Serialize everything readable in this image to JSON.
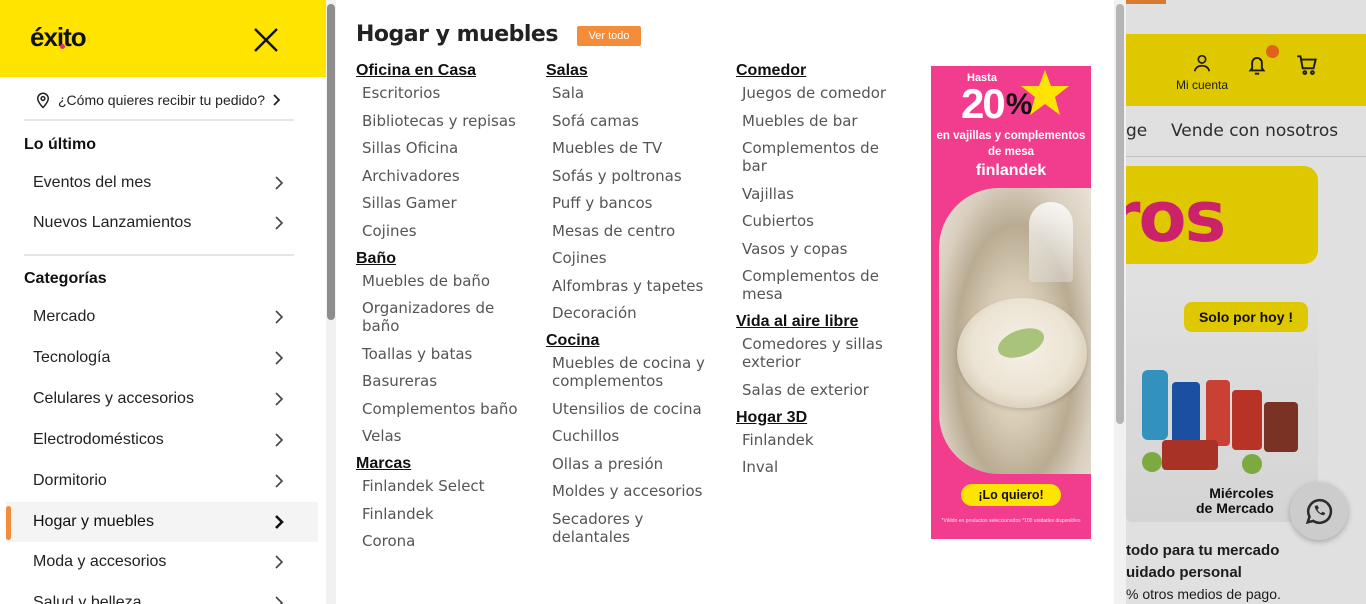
{
  "background": {
    "account_label": "Mi cuenta",
    "nav_partial": "ge",
    "nav_sell": "Vende con nosotros",
    "yellow_card_text": "ros",
    "promo_badge": "Solo por hoy",
    "promo_day": "Miércoles",
    "promo_day_sub": "de Mercado",
    "text_line1": "todo para tu mercado",
    "text_line2": "uidado personal",
    "text_line3": "% otros medios de pago."
  },
  "sidebar": {
    "logo_text": "éxito",
    "delivery_prompt": "¿Cómo quieres recibir tu pedido?",
    "latest_title": "Lo último",
    "latest_items": [
      {
        "label": "Eventos del mes"
      },
      {
        "label": "Nuevos Lanzamientos"
      }
    ],
    "categories_title": "Categorías",
    "categories": [
      {
        "label": "Mercado"
      },
      {
        "label": "Tecnología"
      },
      {
        "label": "Celulares y accesorios"
      },
      {
        "label": "Electrodomésticos"
      },
      {
        "label": "Dormitorio"
      },
      {
        "label": "Hogar y muebles",
        "active": true
      },
      {
        "label": "Moda y accesorios"
      },
      {
        "label": "Salud y belleza"
      }
    ]
  },
  "panel": {
    "title": "Hogar y muebles",
    "see_all": "Ver todo",
    "columns": [
      {
        "groups": [
          {
            "title": "Oficina en Casa",
            "items": [
              "Escritorios",
              "Bibliotecas y repisas",
              "Sillas Oficina",
              "Archivadores",
              "Sillas Gamer",
              "Cojines"
            ]
          },
          {
            "title": "Baño",
            "items": [
              "Muebles de baño",
              "Organizadores de baño",
              "Toallas y batas",
              "Basureras",
              "Complementos baño",
              "Velas"
            ]
          },
          {
            "title": "Marcas",
            "items": [
              "Finlandek Select",
              "Finlandek",
              "Corona"
            ]
          }
        ]
      },
      {
        "groups": [
          {
            "title": "Salas",
            "items": [
              "Sala",
              "Sofá camas",
              "Muebles de TV",
              "Sofás y poltronas",
              "Puff y bancos",
              "Mesas de centro",
              "Cojines",
              "Alfombras y tapetes",
              "Decoración"
            ]
          },
          {
            "title": "Cocina",
            "items": [
              "Muebles de cocina y complementos",
              "Utensilios de cocina",
              "Cuchillos",
              "Ollas a presión",
              "Moldes y accesorios",
              "Secadores y delantales"
            ]
          }
        ]
      },
      {
        "groups": [
          {
            "title": "Comedor",
            "items": [
              "Juegos de comedor",
              "Muebles de bar",
              "Complementos de bar",
              "Vajillas",
              "Cubiertos",
              "Vasos y copas",
              "Complementos de mesa"
            ]
          },
          {
            "title": "Vida al aire libre",
            "items": [
              "Comedores y sillas exterior",
              "Salas de exterior"
            ]
          },
          {
            "title": "Hogar 3D",
            "items": [
              "Finlandek",
              "Inval"
            ]
          }
        ]
      }
    ],
    "ad": {
      "prefix": "Hasta",
      "discount": "20",
      "percent": "%",
      "description": "en vajillas y complementos de mesa",
      "brand": "finlandek",
      "cta": "¡Lo quiero!",
      "legal": "*Válido en productos seleccionados *100 unidades disponibles"
    }
  },
  "colors": {
    "brand_yellow": "#ffe400",
    "accent_orange": "#f58c3a",
    "ad_pink": "#f23d8e"
  }
}
